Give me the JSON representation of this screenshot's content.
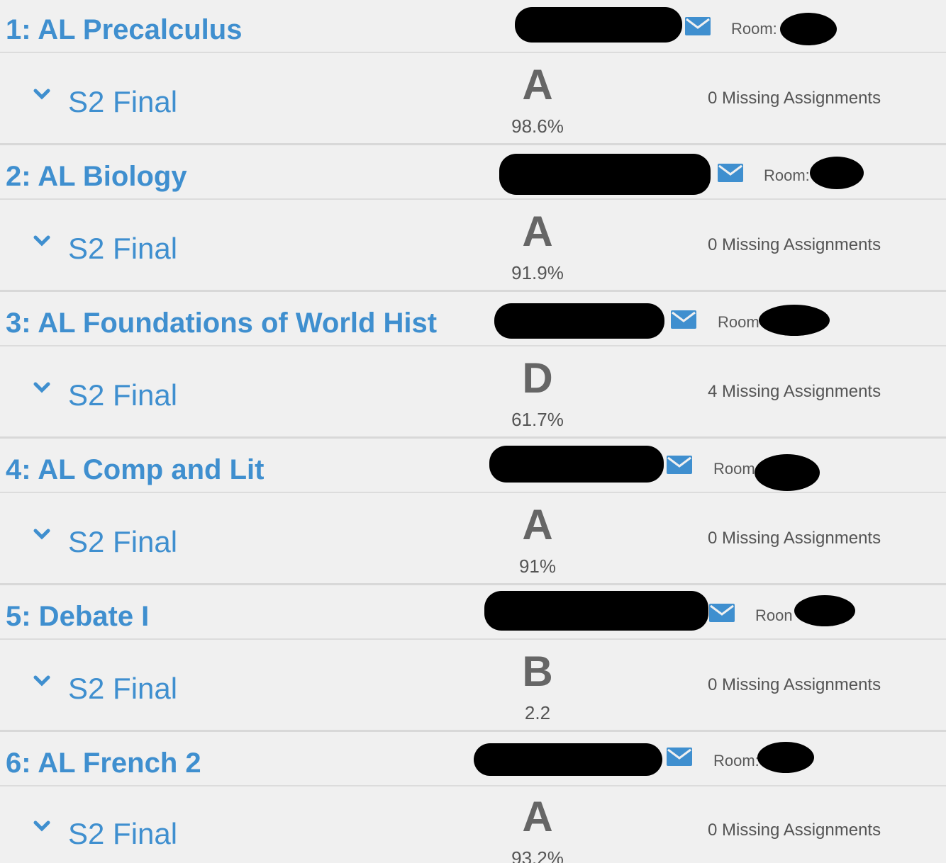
{
  "courses": [
    {
      "title": "1: AL Precalculus",
      "room_label": "Room:",
      "term": "S2 Final",
      "grade": "A",
      "score": "98.6%",
      "missing": "0 Missing Assignments"
    },
    {
      "title": "2: AL Biology",
      "room_label": "Room:",
      "term": "S2 Final",
      "grade": "A",
      "score": "91.9%",
      "missing": "0 Missing Assignments"
    },
    {
      "title": "3: AL Foundations of World Hist",
      "room_label": "Room",
      "term": "S2 Final",
      "grade": "D",
      "score": "61.7%",
      "missing": "4 Missing Assignments"
    },
    {
      "title": "4: AL Comp and Lit",
      "room_label": "Room",
      "term": "S2 Final",
      "grade": "A",
      "score": "91%",
      "missing": "0 Missing Assignments"
    },
    {
      "title": "5: Debate I",
      "room_label": "Roon",
      "term": "S2 Final",
      "grade": "B",
      "score": "2.2",
      "missing": "0 Missing Assignments"
    },
    {
      "title": "6: AL French 2",
      "room_label": "Room:",
      "term": "S2 Final",
      "grade": "A",
      "score": "93.2%",
      "missing": "0 Missing Assignments"
    }
  ],
  "icons": {
    "mail": "envelope-icon",
    "expand": "chevron-down-icon"
  },
  "colors": {
    "link_blue": "#3f8fcf",
    "grade_gray": "#666666",
    "background": "#f0f0f0",
    "redaction": "#000000"
  }
}
